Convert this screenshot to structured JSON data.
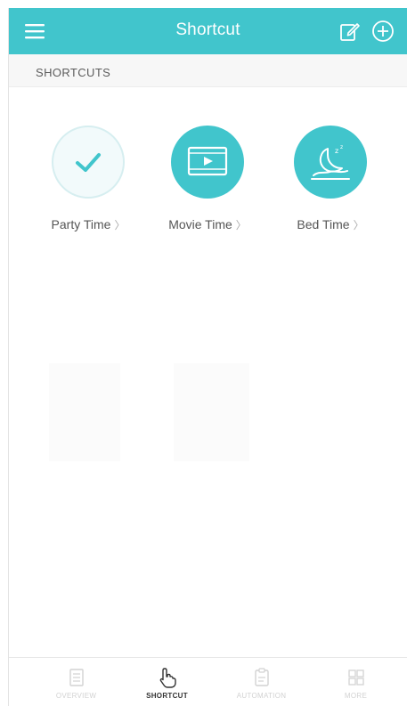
{
  "header": {
    "title": "Shortcut",
    "menu_icon": "menu-icon",
    "edit_icon": "edit-icon",
    "add_icon": "add-circle-icon",
    "background": "#41c5cc"
  },
  "section": {
    "title": "SHORTCUTS"
  },
  "shortcuts": [
    {
      "label": "Party Time",
      "chevron": "〉",
      "icon": "check-icon",
      "style": "outline"
    },
    {
      "label": "Movie Time",
      "chevron": "〉",
      "icon": "movie-icon",
      "style": "filled"
    },
    {
      "label": "Bed Time",
      "chevron": "〉",
      "icon": "moon-icon",
      "style": "filled"
    }
  ],
  "tabs": [
    {
      "label": "OVERVIEW",
      "icon": "overview-icon",
      "active": false
    },
    {
      "label": "SHORTCUT",
      "icon": "hand-pointer-icon",
      "active": true
    },
    {
      "label": "AUTOMATION",
      "icon": "clipboard-icon",
      "active": false
    },
    {
      "label": "MORE",
      "icon": "grid-icon",
      "active": false
    }
  ],
  "colors": {
    "accent": "#41c5cc",
    "text": "#555555",
    "tab_inactive": "#d2d2d2"
  }
}
